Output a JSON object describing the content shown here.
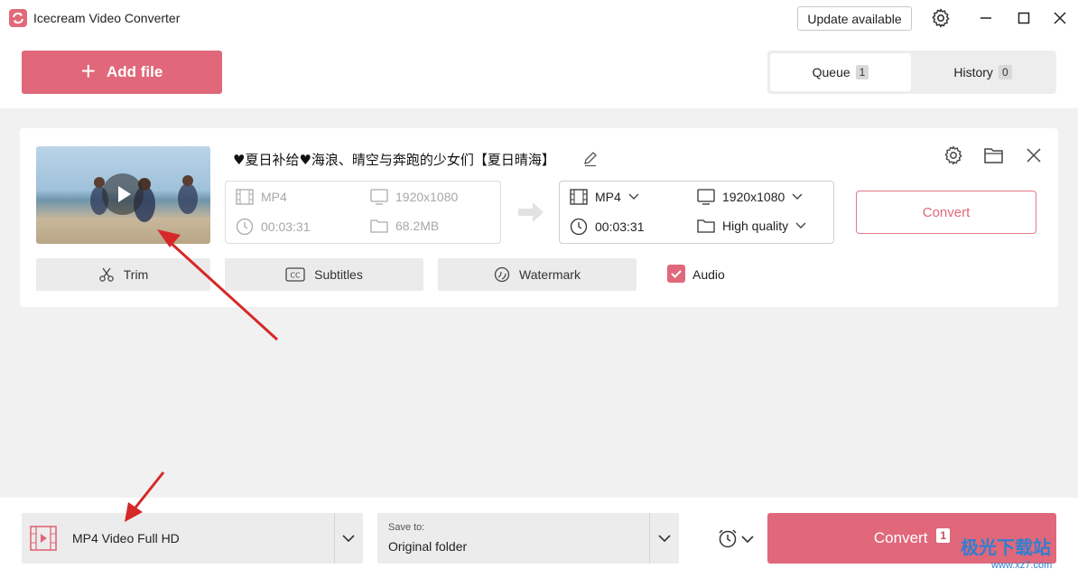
{
  "app": {
    "title": "Icecream Video Converter",
    "update_label": "Update available"
  },
  "toolbar": {
    "add_file_label": "Add file"
  },
  "tabs": [
    {
      "label": "Queue",
      "count": "1",
      "active": true
    },
    {
      "label": "History",
      "count": "0",
      "active": false
    }
  ],
  "file": {
    "title": "♥夏日补给♥海浪、晴空与奔跑的少女们【夏日晴海】",
    "source": {
      "format": "MP4",
      "resolution": "1920x1080",
      "duration": "00:03:31",
      "size": "68.2MB"
    },
    "output": {
      "format": "MP4",
      "resolution": "1920x1080",
      "duration": "00:03:31",
      "quality": "High quality"
    },
    "convert_label": "Convert",
    "tools": {
      "trim": "Trim",
      "subtitles": "Subtitles",
      "watermark": "Watermark",
      "audio": "Audio"
    },
    "audio_checked": true
  },
  "bottom": {
    "preset_label": "MP4 Video Full HD",
    "save_caption": "Save to:",
    "save_value": "Original folder",
    "convert_label": "Convert",
    "convert_count": "1"
  },
  "watermark": {
    "text": "极光下载站",
    "url": "www.xz7.com"
  },
  "colors": {
    "accent": "#e0687a",
    "annotation": "#d62828"
  }
}
